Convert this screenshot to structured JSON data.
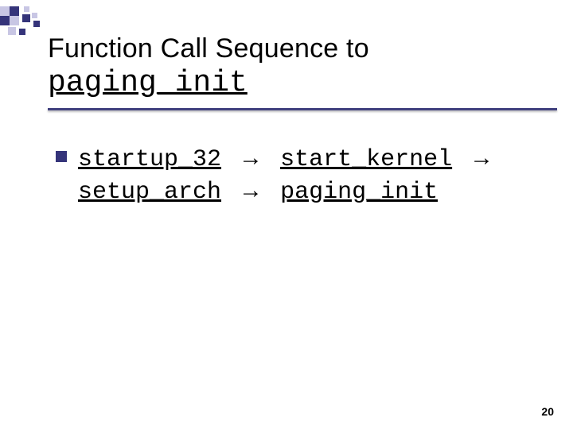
{
  "decoration": {
    "dark": "#35347a",
    "light": "#c8c6e4"
  },
  "title": {
    "line1": "Function Call Sequence to",
    "line2": "paging_init"
  },
  "bullet": {
    "fn1": "startup_32",
    "fn2": "start_kernel",
    "fn3": "setup_arch",
    "fn4": "paging_init",
    "arrow": "→"
  },
  "page_number": "20"
}
